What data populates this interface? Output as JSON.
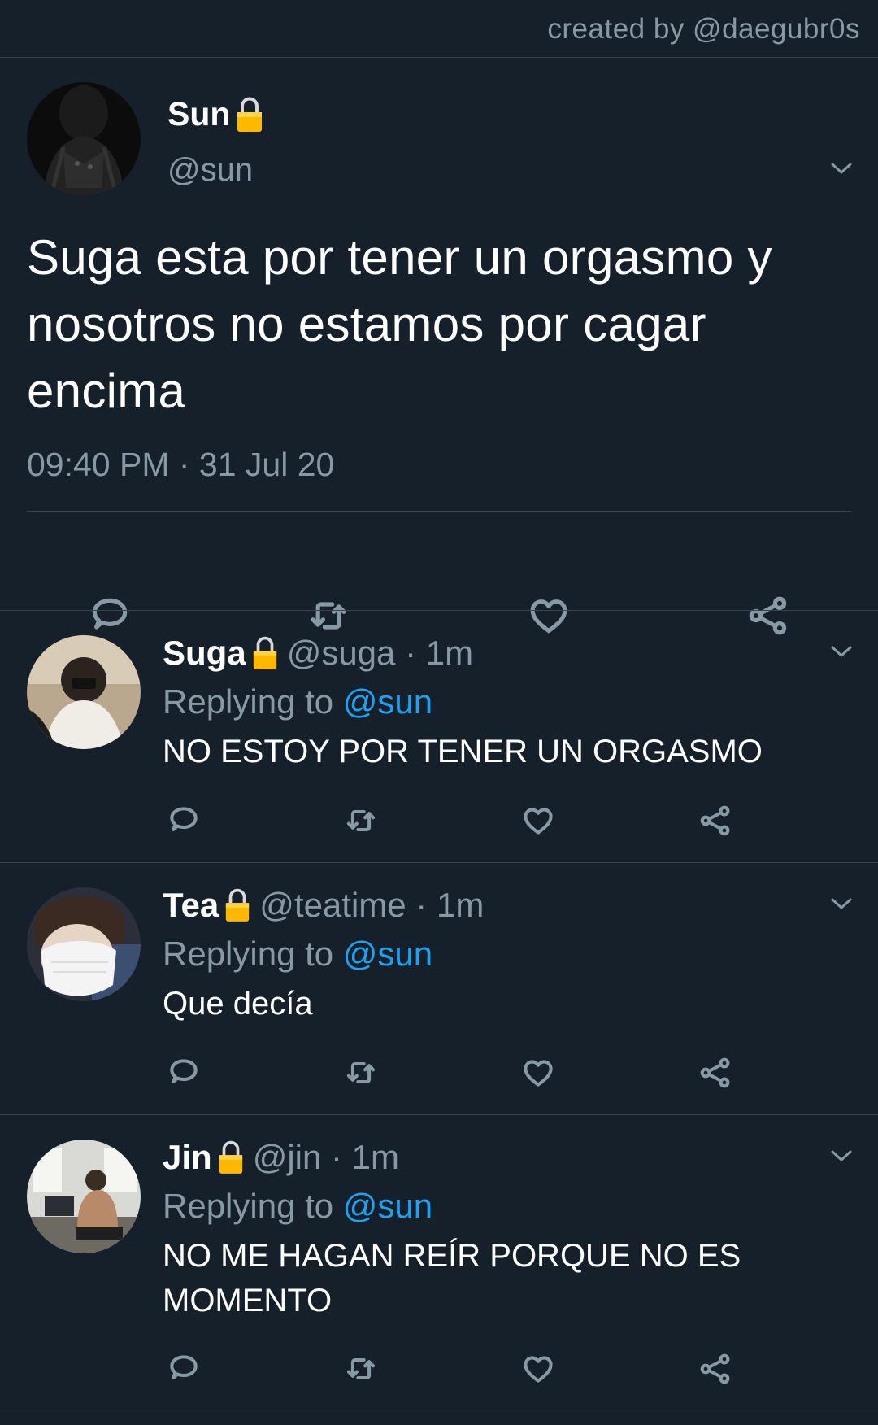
{
  "header": {
    "credit": "created by @daegubr0s"
  },
  "main_tweet": {
    "name": "Sun",
    "handle": "@sun",
    "text": "Suga esta por tener un orgasmo y nosotros no estamos por cagar encima",
    "timestamp": "09:40 PM · 31 Jul 20",
    "icons": [
      "reply-icon",
      "retweet-icon",
      "like-icon",
      "share-icon"
    ]
  },
  "replies": [
    {
      "name": "Suga",
      "meta": "@suga · 1m",
      "replying_prefix": "Replying to ",
      "replying_to": "@sun",
      "text": "NO ESTOY POR TENER UN ORGASMO"
    },
    {
      "name": "Tea",
      "meta": "@teatime · 1m",
      "replying_prefix": "Replying to ",
      "replying_to": "@sun",
      "text": "Que decía"
    },
    {
      "name": "Jin",
      "meta": "@jin · 1m",
      "replying_prefix": "Replying to ",
      "replying_to": "@sun",
      "text": "NO ME HAGAN REÍR PORQUE NO ES MOMENTO"
    }
  ],
  "colors": {
    "background": "#15202b",
    "muted_text": "#8899a6",
    "link": "#1da1f2",
    "divider": "#38444d",
    "lock": "#ffb800"
  }
}
